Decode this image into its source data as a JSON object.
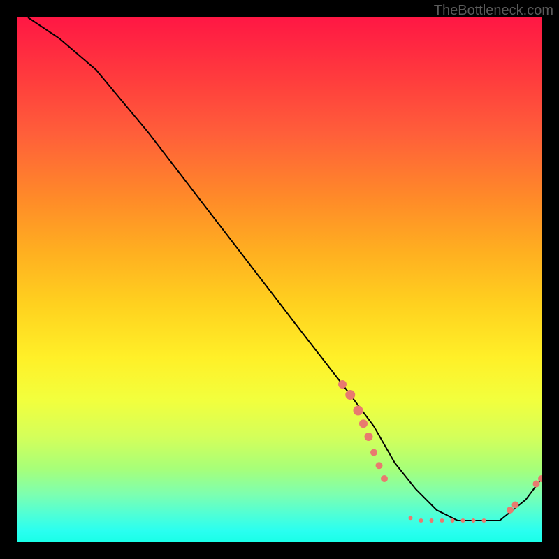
{
  "watermark": "TheBottleneck.com",
  "chart_data": {
    "type": "line",
    "title": "",
    "xlabel": "",
    "ylabel": "",
    "xlim": [
      0,
      100
    ],
    "ylim": [
      0,
      100
    ],
    "series": [
      {
        "name": "bottleneck-curve",
        "x": [
          2,
          8,
          15,
          25,
          35,
          45,
          55,
          62,
          68,
          72,
          76,
          80,
          84,
          88,
          92,
          97,
          100
        ],
        "y": [
          100,
          96,
          90,
          78,
          65,
          52,
          39,
          30,
          22,
          15,
          10,
          6,
          4,
          4,
          4,
          8,
          12
        ]
      }
    ],
    "markers": {
      "name": "highlight-dots",
      "points": [
        {
          "x": 62,
          "y": 30,
          "r": 6
        },
        {
          "x": 63.5,
          "y": 28,
          "r": 7
        },
        {
          "x": 65,
          "y": 25,
          "r": 7
        },
        {
          "x": 66,
          "y": 22.5,
          "r": 6
        },
        {
          "x": 67,
          "y": 20,
          "r": 6
        },
        {
          "x": 68,
          "y": 17,
          "r": 5
        },
        {
          "x": 69,
          "y": 14.5,
          "r": 5
        },
        {
          "x": 70,
          "y": 12,
          "r": 5
        },
        {
          "x": 75,
          "y": 4.5,
          "r": 3
        },
        {
          "x": 77,
          "y": 4,
          "r": 3
        },
        {
          "x": 79,
          "y": 4,
          "r": 3
        },
        {
          "x": 81,
          "y": 4,
          "r": 3
        },
        {
          "x": 83,
          "y": 4,
          "r": 3
        },
        {
          "x": 85,
          "y": 4,
          "r": 3
        },
        {
          "x": 87,
          "y": 4,
          "r": 3
        },
        {
          "x": 89,
          "y": 4,
          "r": 3
        },
        {
          "x": 94,
          "y": 6,
          "r": 5
        },
        {
          "x": 95,
          "y": 7,
          "r": 5
        },
        {
          "x": 99,
          "y": 11,
          "r": 5
        },
        {
          "x": 100,
          "y": 12,
          "r": 5
        }
      ]
    },
    "gradient_stops": [
      {
        "pos": 0,
        "color": "#ff1744"
      },
      {
        "pos": 50,
        "color": "#ffd21f"
      },
      {
        "pos": 100,
        "color": "#1affe8"
      }
    ]
  }
}
